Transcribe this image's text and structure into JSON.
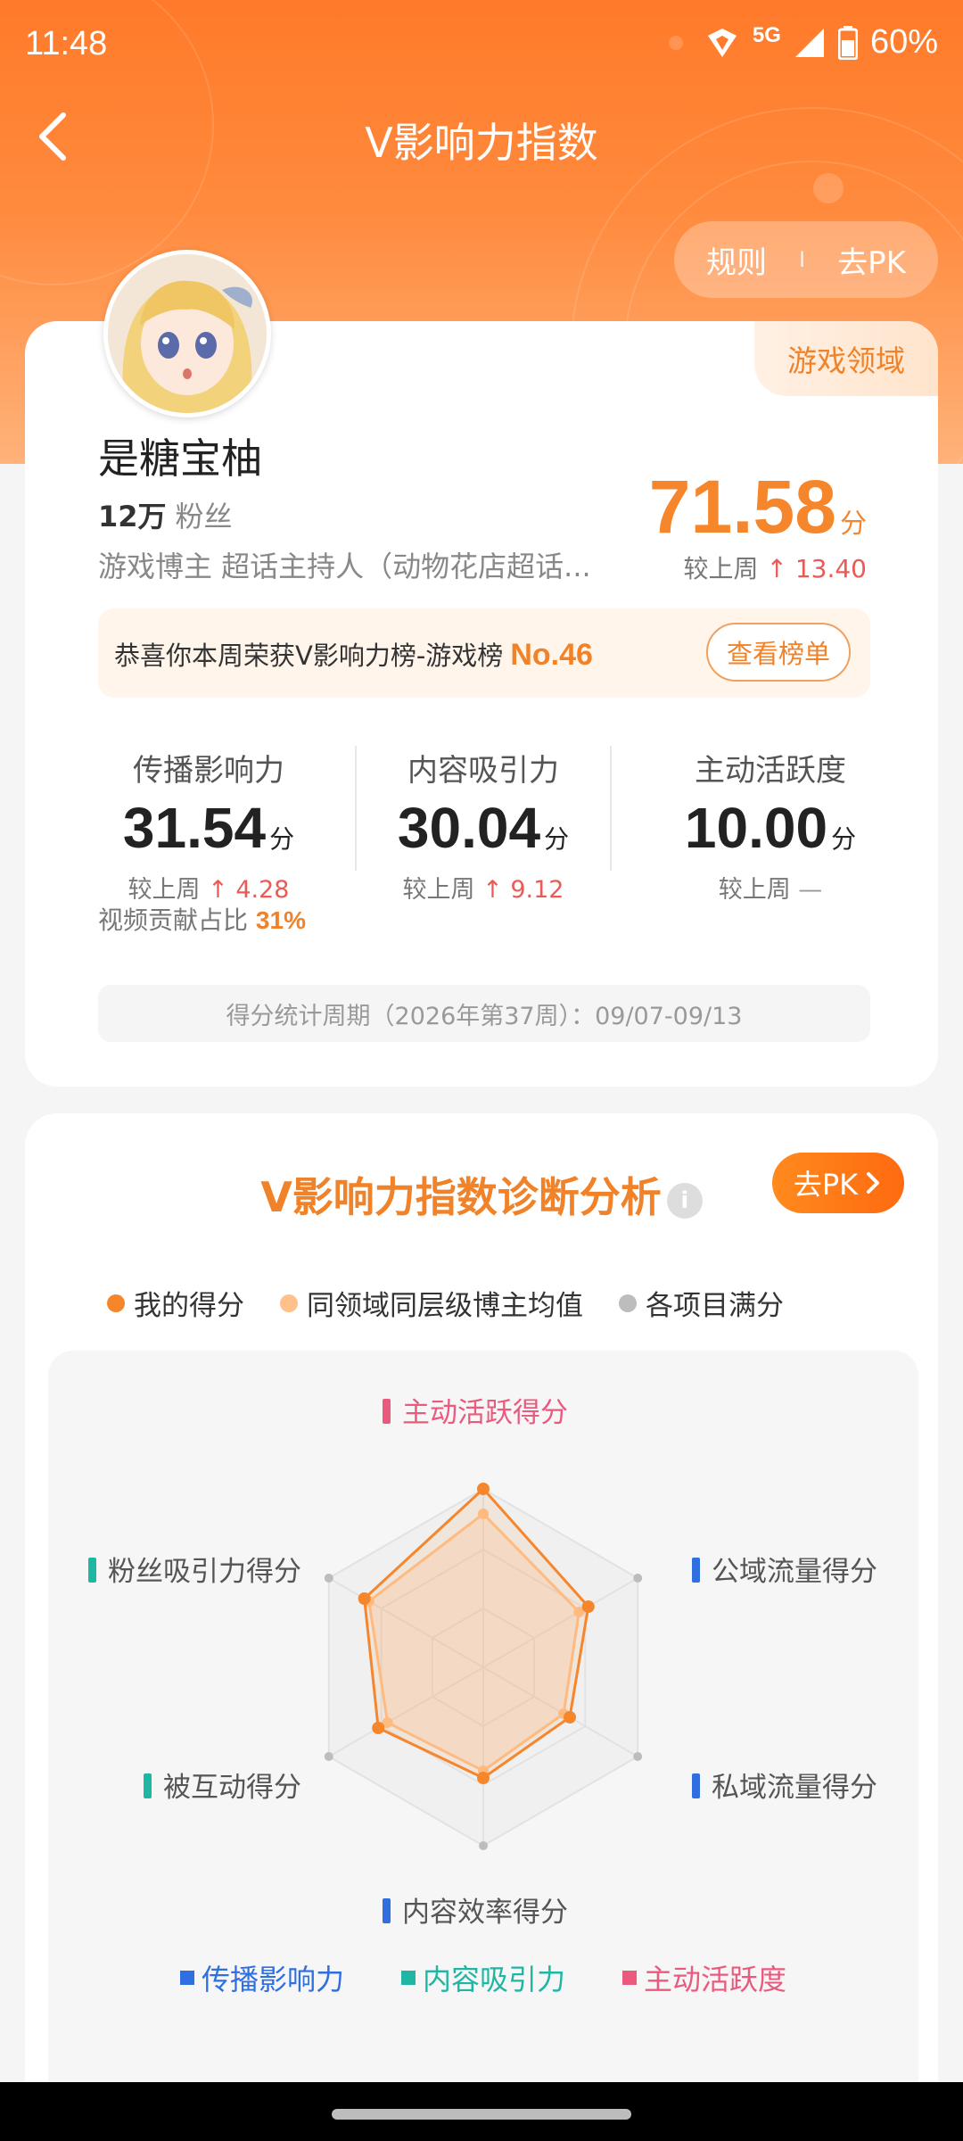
{
  "status_bar": {
    "time": "11:48",
    "network": "5G",
    "battery": "60%"
  },
  "header": {
    "title": "V影响力指数",
    "rules_label": "规则",
    "divider": "I",
    "pk_label": "去PK"
  },
  "profile": {
    "domain_tag": "游戏领域",
    "name": "是糖宝柚",
    "fans_count": "12万",
    "fans_label": "粉丝",
    "bio": "游戏博主 超话主持人（动物花店超话...",
    "total_score": "71.58",
    "score_unit": "分",
    "delta_label": "较上周",
    "delta_value": "13.40"
  },
  "rank_banner": {
    "text": "恭喜你本周荣获V影响力榜-游戏榜",
    "rank": "No.46",
    "button": "查看榜单"
  },
  "metrics": [
    {
      "label": "传播影响力",
      "value": "31.54",
      "unit": "分",
      "delta_label": "较上周",
      "delta": "4.28",
      "trend": "up"
    },
    {
      "label": "内容吸引力",
      "value": "30.04",
      "unit": "分",
      "delta_label": "较上周",
      "delta": "9.12",
      "trend": "up"
    },
    {
      "label": "主动活跃度",
      "value": "10.00",
      "unit": "分",
      "delta_label": "较上周",
      "delta": "—",
      "trend": "flat"
    }
  ],
  "video_ratio": {
    "label": "视频贡献占比",
    "value": "31%"
  },
  "period": "得分统计周期（2026年第37周）：09/07-09/13",
  "analysis": {
    "title": "V影响力指数诊断分析",
    "pk_button": "去PK",
    "legend": [
      {
        "label": "我的得分",
        "color": "#f6862c"
      },
      {
        "label": "同领域同层级博主均值",
        "color": "#ffc08a"
      },
      {
        "label": "各项目满分",
        "color": "#bdbdbd"
      }
    ],
    "axes": [
      {
        "label": "主动活跃得分",
        "color": "#ea5a7e"
      },
      {
        "label": "公域流量得分",
        "color": "#2f6fe0"
      },
      {
        "label": "私域流量得分",
        "color": "#2f6fe0"
      },
      {
        "label": "内容效率得分",
        "color": "#2f6fe0"
      },
      {
        "label": "被互动得分",
        "color": "#1fb6a4"
      },
      {
        "label": "粉丝吸引力得分",
        "color": "#1fb6a4"
      }
    ],
    "my_scores": [
      1.0,
      0.68,
      0.56,
      0.62,
      0.68,
      0.77
    ],
    "avg_scores": [
      0.86,
      0.62,
      0.52,
      0.58,
      0.62,
      0.74
    ],
    "category_legend": [
      {
        "label": "传播影响力",
        "color": "#2f6fe0"
      },
      {
        "label": "内容吸引力",
        "color": "#1fb6a4"
      },
      {
        "label": "主动活跃度",
        "color": "#ea5a7e"
      }
    ]
  }
}
